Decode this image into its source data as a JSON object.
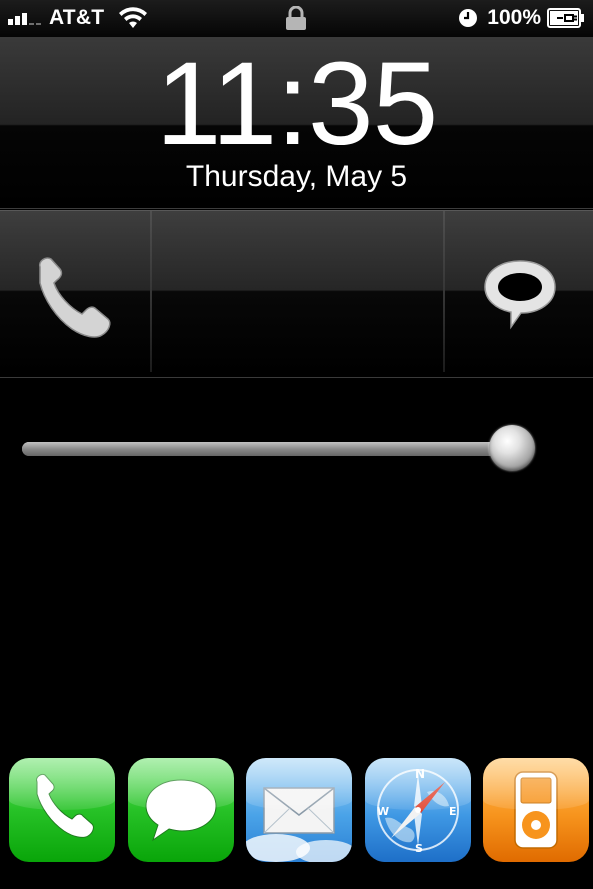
{
  "status_bar": {
    "carrier": "AT&T",
    "battery_percent": "100%",
    "signal_bars": 3,
    "signal_bars_total": 5,
    "icons": [
      "signal-icon",
      "wifi-icon",
      "lock-icon",
      "alarm-clock-icon",
      "battery-charging-icon"
    ]
  },
  "lock_screen": {
    "time": "11:35",
    "date": "Thursday, May 5"
  },
  "action_panel": {
    "left_icon": "phone-handset-icon",
    "right_icon": "speech-bubble-icon"
  },
  "slider": {
    "value_fraction": 1.0
  },
  "dock": {
    "apps": [
      {
        "name": "phone",
        "icon": "phone-app-icon"
      },
      {
        "name": "messages",
        "icon": "messages-app-icon"
      },
      {
        "name": "mail",
        "icon": "mail-app-icon"
      },
      {
        "name": "safari",
        "icon": "safari-app-icon"
      },
      {
        "name": "ipod",
        "icon": "ipod-app-icon"
      }
    ]
  },
  "colors": {
    "background": "#000000",
    "green_icon": "#27c227",
    "blue_icon": "#3f98e4",
    "orange_icon": "#f7941d"
  }
}
